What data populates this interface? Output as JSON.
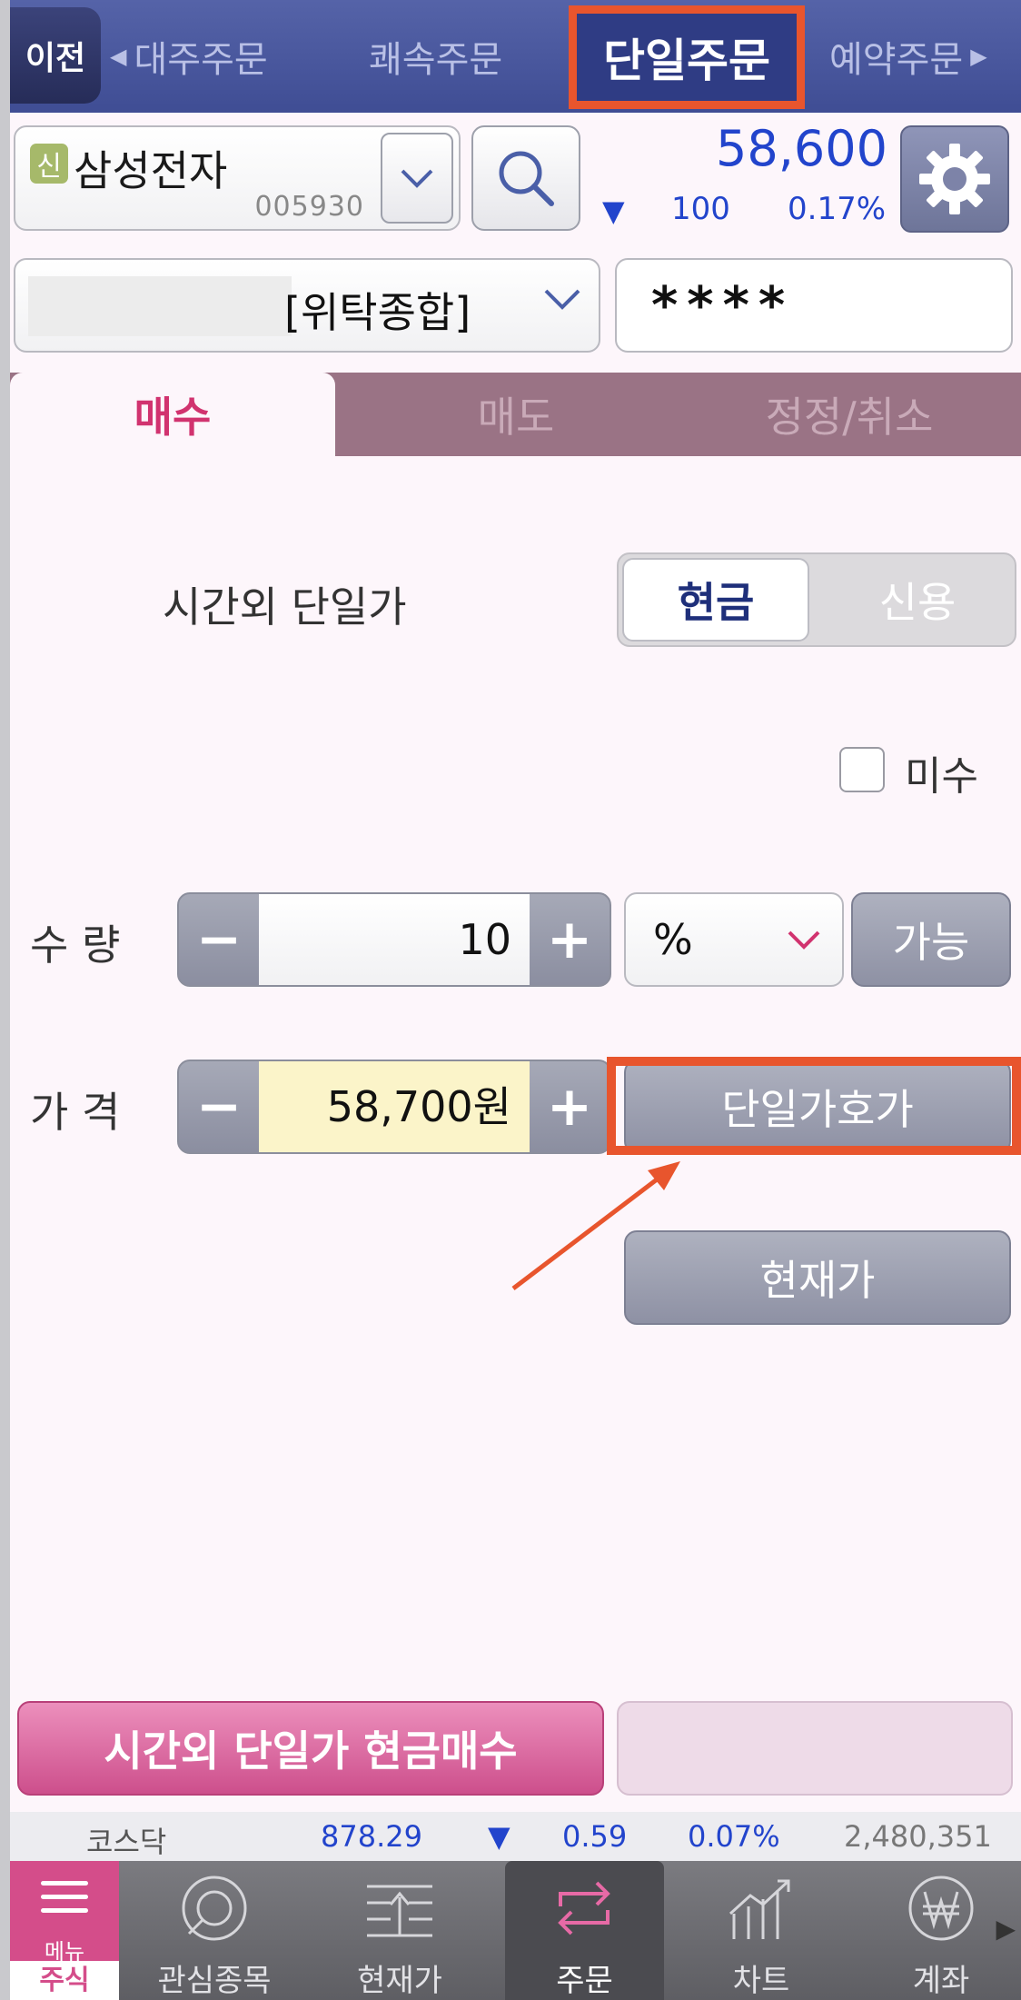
{
  "topnav": {
    "back_label": "이전",
    "items": [
      "대주주문",
      "쾌속주문",
      "단일주문",
      "예약주문"
    ],
    "active_index": 2
  },
  "stock": {
    "badge": "신",
    "name": "삼성전자",
    "code": "005930",
    "price": "58,600",
    "change_dir": "▼",
    "change": "100",
    "change_pct": "0.17%"
  },
  "account": {
    "type": "[위탁종합]",
    "password_mask": "****"
  },
  "tabs": [
    "매수",
    "매도",
    "정정/취소"
  ],
  "active_tab": 0,
  "form": {
    "session_label": "시간외 단일가",
    "segment_options": [
      "현금",
      "신용"
    ],
    "segment_selected": 0,
    "missu_label": "미수",
    "missu_checked": false,
    "qty_label": "수 량",
    "qty_value": "10",
    "qty_unit": "%",
    "avail_button": "가능",
    "price_label": "가 격",
    "price_value": "58,700원",
    "single_quote_button": "단일가호가",
    "current_price_button": "현재가",
    "minus": "−",
    "plus": "+"
  },
  "order_button": "시간외 단일가 현금매수",
  "ticker": {
    "market": "코스닥",
    "index": "878.29",
    "dir": "▼",
    "change": "0.59",
    "change_pct": "0.07%",
    "volume": "2,480,351"
  },
  "tabbar": {
    "menu_label": "메뉴",
    "menu_sub": "주식",
    "items": [
      "관심종목",
      "현재가",
      "주문",
      "차트",
      "계좌"
    ],
    "active_index": 2
  },
  "colors": {
    "accent_pink": "#d1336f",
    "price_blue": "#2244cc",
    "highlight": "#e8552d",
    "nav_blue": "#3f4d94"
  }
}
